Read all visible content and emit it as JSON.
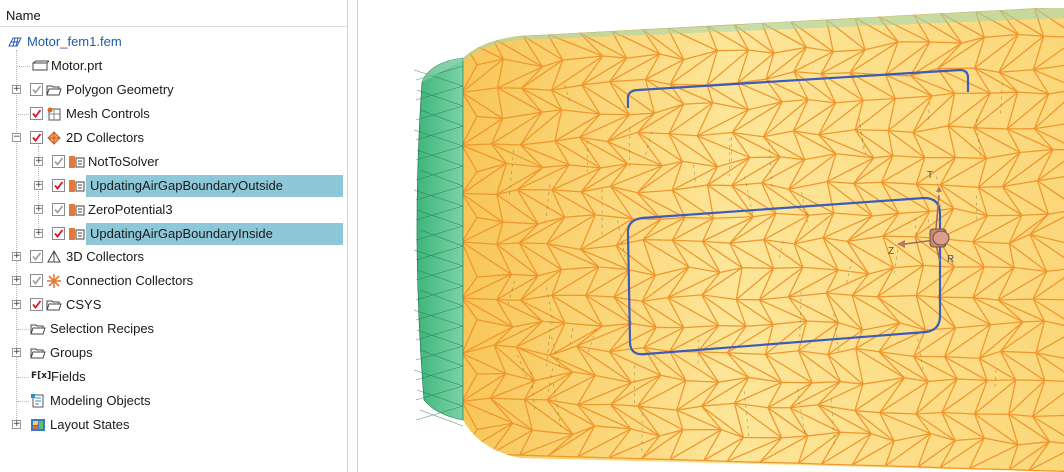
{
  "tree": {
    "header": "Name",
    "root_label": "Motor_fem1.fem",
    "items": [
      {
        "label": "Motor.prt"
      },
      {
        "label": "Polygon Geometry"
      },
      {
        "label": "Mesh Controls"
      },
      {
        "label": "2D Collectors"
      },
      {
        "label": "NotToSolver"
      },
      {
        "label": "UpdatingAirGapBoundaryOutside"
      },
      {
        "label": "ZeroPotential3"
      },
      {
        "label": "UpdatingAirGapBoundaryInside"
      },
      {
        "label": "3D Collectors"
      },
      {
        "label": "Connection Collectors"
      },
      {
        "label": "CSYS"
      },
      {
        "label": "Selection Recipes"
      },
      {
        "label": "Groups"
      },
      {
        "label": "Fields"
      },
      {
        "label": "Modeling Objects"
      },
      {
        "label": "Layout States"
      }
    ],
    "fields_icon_text": "F[x]"
  },
  "viewport": {
    "csys_axis_labels": [
      "T",
      "Z",
      "R"
    ]
  },
  "colors": {
    "selection": "#8ec7d8",
    "mesh_face": "#f9d872",
    "mesh_edge": "#f0982e",
    "end_cap": "#63c796",
    "boundary_curve": "#3d5bb8",
    "checkmark_red": "#e0151f",
    "root_label": "#1f5aa8"
  }
}
